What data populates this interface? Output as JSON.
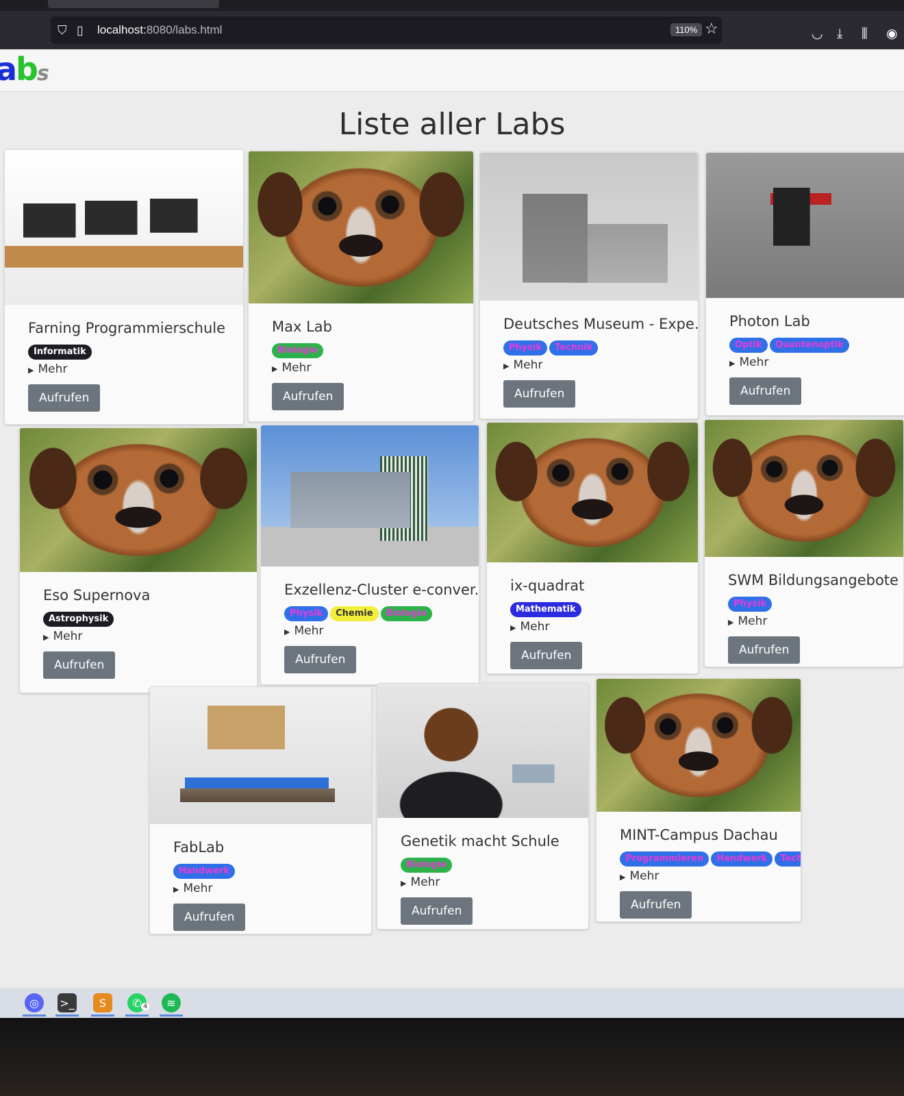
{
  "browser": {
    "url_host": "localhost:",
    "url_rest": "8080/labs.html",
    "zoom": "110%"
  },
  "logo": {
    "part1": "a",
    "part2": "b",
    "part3": "s"
  },
  "page_title": "Liste aller Labs",
  "colors": {
    "tag_dark": "#1c1c24",
    "tag_green": "#2bb34a",
    "tag_blue": "#2f6fe8",
    "tag_indigo": "#2c2be0",
    "tag_yellow": "#f2ef3a",
    "tag_green_text": "#e83ad9",
    "tag_blue_text": "#e83ad9",
    "button": "#6c757d"
  },
  "cards": [
    {
      "title": "Farning Programmierschule",
      "image": "office",
      "tags": [
        {
          "label": "Informatik",
          "style": "dark"
        }
      ],
      "mehr": "Mehr",
      "button": "Aufrufen"
    },
    {
      "title": "Max Lab",
      "image": "dog",
      "tags": [
        {
          "label": "Biologie",
          "style": "green"
        }
      ],
      "mehr": "Mehr",
      "button": "Aufrufen"
    },
    {
      "title": "Deutsches Museum - Expe...",
      "image": "museum",
      "tags": [
        {
          "label": "Physik",
          "style": "blue"
        },
        {
          "label": "Technik",
          "style": "blue"
        }
      ],
      "mehr": "Mehr",
      "button": "Aufrufen"
    },
    {
      "title": "Photon Lab",
      "image": "photon",
      "tags": [
        {
          "label": "Optik",
          "style": "blue"
        },
        {
          "label": "Quantenoptik",
          "style": "blue"
        }
      ],
      "mehr": "Mehr",
      "button": "Aufrufen"
    },
    {
      "title": "Eso Supernova",
      "image": "dog",
      "tags": [
        {
          "label": "Astrophysik",
          "style": "dark"
        }
      ],
      "mehr": "Mehr",
      "button": "Aufrufen"
    },
    {
      "title": "Exzellenz-Cluster e-conver...",
      "image": "campus",
      "tags": [
        {
          "label": "Physik",
          "style": "blue"
        },
        {
          "label": "Chemie",
          "style": "yellow"
        },
        {
          "label": "Biologie",
          "style": "green"
        }
      ],
      "mehr": "Mehr",
      "button": "Aufrufen"
    },
    {
      "title": "ix-quadrat",
      "image": "dog",
      "tags": [
        {
          "label": "Mathematik",
          "style": "indigo"
        }
      ],
      "mehr": "Mehr",
      "button": "Aufrufen"
    },
    {
      "title": "SWM Bildungsangebote",
      "image": "dog",
      "tags": [
        {
          "label": "Physik",
          "style": "blue"
        }
      ],
      "mehr": "Mehr",
      "button": "Aufrufen"
    },
    {
      "title": "FabLab",
      "image": "fablab",
      "tags": [
        {
          "label": "Handwerk",
          "style": "blue"
        }
      ],
      "mehr": "Mehr",
      "button": "Aufrufen"
    },
    {
      "title": "Genetik macht Schule",
      "image": "genetik",
      "tags": [
        {
          "label": "Biologie",
          "style": "green"
        }
      ],
      "mehr": "Mehr",
      "button": "Aufrufen"
    },
    {
      "title": "MINT-Campus Dachau",
      "image": "dog",
      "tags": [
        {
          "label": "Programmieren",
          "style": "blue"
        },
        {
          "label": "Handwerk",
          "style": "blue"
        },
        {
          "label": "Technik",
          "style": "blue"
        }
      ],
      "mehr": "Mehr",
      "button": "Aufrufen"
    }
  ],
  "taskbar": {
    "whatsapp_badge": "4"
  }
}
